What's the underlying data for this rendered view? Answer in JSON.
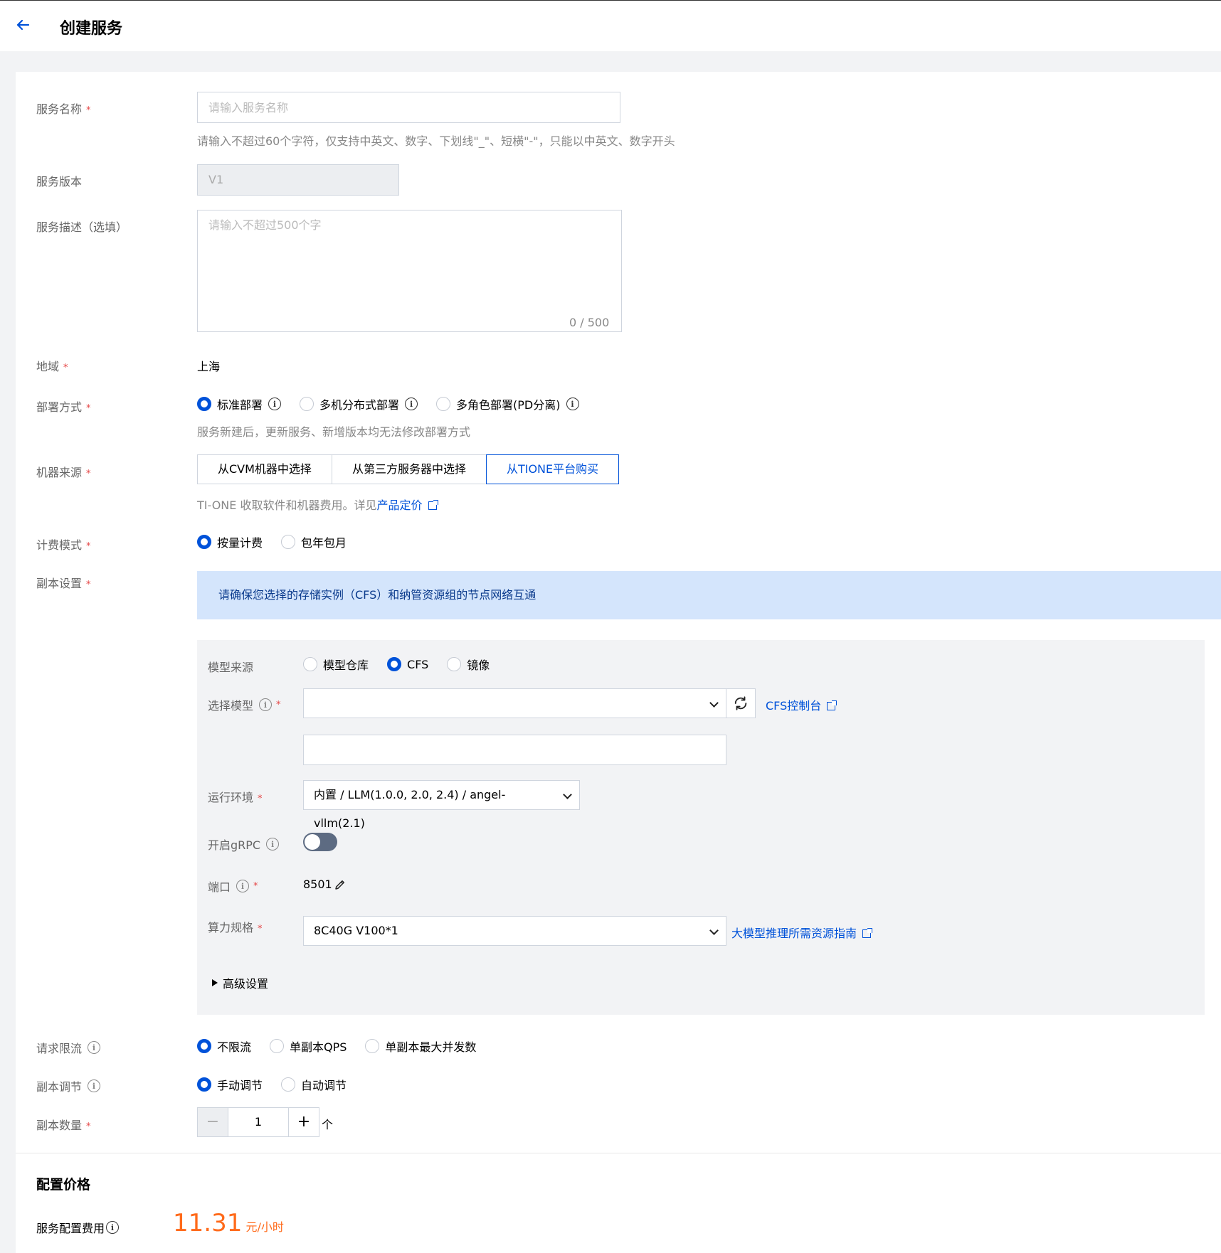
{
  "header": {
    "title": "创建服务"
  },
  "form": {
    "service_name": {
      "label": "服务名称",
      "placeholder": "请输入服务名称",
      "value": "",
      "hint": "请输入不超过60个字符，仅支持中英文、数字、下划线\"_\"、短横\"-\"，只能以中英文、数字开头"
    },
    "service_version": {
      "label": "服务版本",
      "value": "V1"
    },
    "service_desc": {
      "label": "服务描述（选填）",
      "placeholder": "请输入不超过500个字",
      "counter": "0 / 500"
    },
    "region": {
      "label": "地域",
      "value": "上海"
    },
    "deploy_mode": {
      "label": "部署方式",
      "options": [
        {
          "label": "标准部署",
          "selected": true
        },
        {
          "label": "多机分布式部署",
          "selected": false
        },
        {
          "label": "多角色部署(PD分离)",
          "selected": false
        }
      ],
      "hint": "服务新建后，更新服务、新增版本均无法修改部署方式"
    },
    "machine_source": {
      "label": "机器来源",
      "options": [
        "从CVM机器中选择",
        "从第三方服务器中选择",
        "从TIONE平台购买"
      ],
      "selected": "从TIONE平台购买",
      "hint_prefix": "TI-ONE 收取软件和机器费用。详见",
      "hint_link": "产品定价"
    },
    "billing_mode": {
      "label": "计费模式",
      "options": [
        {
          "label": "按量计费",
          "selected": true
        },
        {
          "label": "包年包月",
          "selected": false
        }
      ]
    },
    "replica_settings": {
      "label": "副本设置",
      "notice": "请确保您选择的存储实例（CFS）和纳管资源组的节点网络互通",
      "model_source": {
        "label": "模型来源",
        "options": [
          {
            "label": "模型仓库",
            "selected": false
          },
          {
            "label": "CFS",
            "selected": true
          },
          {
            "label": "镜像",
            "selected": false
          }
        ]
      },
      "select_model": {
        "label": "选择模型",
        "value": "",
        "path_value": "",
        "console_link": "CFS控制台"
      },
      "runtime": {
        "label": "运行环境",
        "value": "内置 / LLM(1.0.0, 2.0, 2.4) / angel-vllm(2.1)"
      },
      "grpc": {
        "label": "开启gRPC",
        "enabled": false
      },
      "port": {
        "label": "端口",
        "value": "8501"
      },
      "compute_spec": {
        "label": "算力规格",
        "value": "8C40G V100*1",
        "guide_link": "大模型推理所需资源指南"
      },
      "advanced": {
        "label": "高级设置"
      }
    },
    "rate_limit": {
      "label": "请求限流",
      "options": [
        {
          "label": "不限流",
          "selected": true
        },
        {
          "label": "单副本QPS",
          "selected": false
        },
        {
          "label": "单副本最大并发数",
          "selected": false
        }
      ]
    },
    "replica_adjust": {
      "label": "副本调节",
      "options": [
        {
          "label": "手动调节",
          "selected": true
        },
        {
          "label": "自动调节",
          "selected": false
        }
      ]
    },
    "replica_count": {
      "label": "副本数量",
      "value": "1",
      "unit": "个",
      "minus": "−",
      "plus": "+"
    }
  },
  "pricing": {
    "title": "配置价格",
    "fee_label": "服务配置费用",
    "price": "11.31",
    "unit": "元/小时"
  },
  "colors": {
    "primary": "#0052d9",
    "required": "#e54545",
    "price": "#ff6a1a",
    "notice_bg": "#d4e5fc"
  }
}
